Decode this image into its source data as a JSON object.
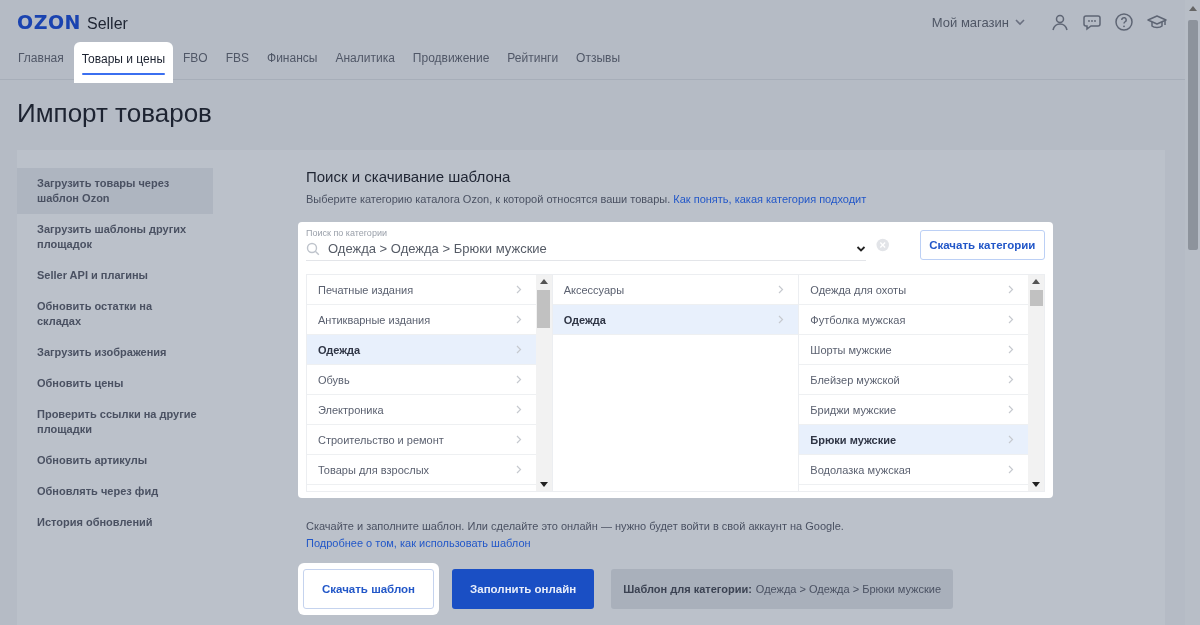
{
  "header": {
    "logo": "OZON",
    "logo_suffix": "Seller",
    "account": "Мой магазин"
  },
  "nav": [
    {
      "label": "Главная",
      "selected": false,
      "highlighted": false
    },
    {
      "label": "Товары и цены",
      "selected": true,
      "highlighted": true
    },
    {
      "label": "FBO",
      "selected": false,
      "highlighted": false
    },
    {
      "label": "FBS",
      "selected": false,
      "highlighted": false
    },
    {
      "label": "Финансы",
      "selected": false,
      "highlighted": false
    },
    {
      "label": "Аналитика",
      "selected": false,
      "highlighted": false
    },
    {
      "label": "Продвижение",
      "selected": false,
      "highlighted": false
    },
    {
      "label": "Рейтинги",
      "selected": false,
      "highlighted": false
    },
    {
      "label": "Отзывы",
      "selected": false,
      "highlighted": false
    }
  ],
  "page_title": "Импорт товаров",
  "sidebar": {
    "items": [
      {
        "label": "Загрузить товары через шаблон Ozon",
        "selected": true
      },
      {
        "label": "Загрузить шаблоны других площадок",
        "selected": false
      },
      {
        "label": "Seller API и плагины",
        "selected": false
      },
      {
        "label": "Обновить остатки на складах",
        "selected": false
      },
      {
        "label": "Загрузить изображения",
        "selected": false
      },
      {
        "label": "Обновить цены",
        "selected": false
      },
      {
        "label": "Проверить ссылки на другие площадки",
        "selected": false
      },
      {
        "label": "Обновить артикулы",
        "selected": false
      },
      {
        "label": "Обновлять через фид",
        "selected": false
      },
      {
        "label": "История обновлений",
        "selected": false
      }
    ]
  },
  "section": {
    "title": "Поиск и скачивание шаблона",
    "description": "Выберите категорию каталога Ozon, к которой относятся ваши товары.",
    "description_link": "Как понять, какая категория подходит"
  },
  "picker": {
    "highlighted": true,
    "search": {
      "label": "Поиск по категории",
      "value": "Одежда > Одежда > Брюки мужские"
    },
    "download_button": "Скачать категории",
    "columns": [
      [
        {
          "label": "Печатные издания",
          "selected": false
        },
        {
          "label": "Антикварные издания",
          "selected": false
        },
        {
          "label": "Одежда",
          "selected": true
        },
        {
          "label": "Обувь",
          "selected": false
        },
        {
          "label": "Электроника",
          "selected": false
        },
        {
          "label": "Строительство и ремонт",
          "selected": false
        },
        {
          "label": "Товары для взрослых",
          "selected": false
        }
      ],
      [
        {
          "label": "Аксессуары",
          "selected": false
        },
        {
          "label": "Одежда",
          "selected": true
        }
      ],
      [
        {
          "label": "Одежда для охоты",
          "selected": false
        },
        {
          "label": "Футболка мужская",
          "selected": false
        },
        {
          "label": "Шорты мужские",
          "selected": false
        },
        {
          "label": "Блейзер мужской",
          "selected": false
        },
        {
          "label": "Бриджи мужские",
          "selected": false
        },
        {
          "label": "Брюки мужские",
          "selected": true
        },
        {
          "label": "Водолазка мужская",
          "selected": false
        }
      ]
    ]
  },
  "hint": {
    "text": "Скачайте и заполните шаблон. Или сделайте это онлайн — нужно будет войти в свой аккаунт на Google.",
    "link": "Подробнее о том, как использовать шаблон"
  },
  "actions": [
    {
      "label": "Скачать шаблон",
      "kind": "outline",
      "highlighted": true
    },
    {
      "label": "Заполнить онлайн",
      "kind": "primary",
      "highlighted": false
    }
  ],
  "template_info": {
    "label": "Шаблон для категории:",
    "value": "Одежда > Одежда > Брюки мужские"
  }
}
